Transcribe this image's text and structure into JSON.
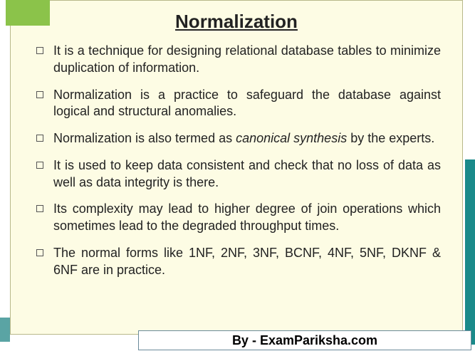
{
  "slide": {
    "title": "Normalization",
    "bullets": [
      {
        "text": "It is a technique for designing relational database tables to minimize duplication of information."
      },
      {
        "text": "Normalization is a practice to safeguard the database against logical and structural anomalies."
      },
      {
        "text_pre": "Normalization is also termed as ",
        "text_italic": "canonical synthesis",
        "text_post": " by the experts."
      },
      {
        "text": "It is used to keep data consistent and check that no loss of data as well as data integrity is there."
      },
      {
        "text": "Its complexity may lead to higher degree of join operations which sometimes lead to the degraded throughput times."
      },
      {
        "text": "The normal forms like 1NF, 2NF, 3NF, BCNF, 4NF, 5NF, DKNF & 6NF are in practice."
      }
    ]
  },
  "attribution": "By - ExamPariksha.com",
  "colors": {
    "slide_bg": "#fdfce4",
    "accent_green": "#8bc34a",
    "accent_teal": "#1a8a8a"
  }
}
